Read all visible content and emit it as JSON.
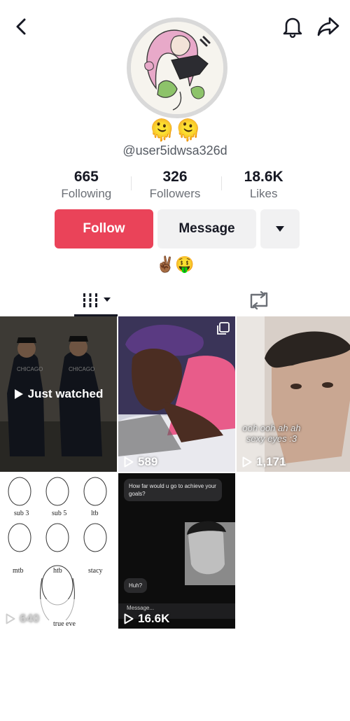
{
  "profile": {
    "nickname": "🫠🫠",
    "username": "@user5idwsa326d",
    "bio": "✌🏾🤑"
  },
  "stats": [
    {
      "value": "665",
      "label": "Following"
    },
    {
      "value": "326",
      "label": "Followers"
    },
    {
      "value": "18.6K",
      "label": "Likes"
    }
  ],
  "actions": {
    "follow_label": "Follow",
    "message_label": "Message"
  },
  "colors": {
    "follow": "#ea4359",
    "text": "#161823",
    "muted": "#6b6f76"
  },
  "videos": [
    {
      "badge": "Just watched",
      "scene_text": [
        "CHICAGO",
        "CHICAGO"
      ]
    },
    {
      "views": "589"
    },
    {
      "views": "1,171",
      "caption": "ooh ooh ah ah\nsexy eyes :3"
    },
    {
      "views": "640",
      "labels": [
        "sub 3",
        "sub 5",
        "ltb",
        "mtb",
        "htb",
        "stacy",
        "true eve"
      ]
    },
    {
      "views": "16.6K",
      "chat_top": "How far would u go to achieve your goals?",
      "chat_reply": "Huh?",
      "composer": "Message..."
    }
  ],
  "icons": [
    "back-icon",
    "bell-icon",
    "share-icon",
    "chevron-down-icon",
    "videos-grid-icon",
    "repost-icon",
    "play-icon",
    "multi-photo-icon"
  ]
}
